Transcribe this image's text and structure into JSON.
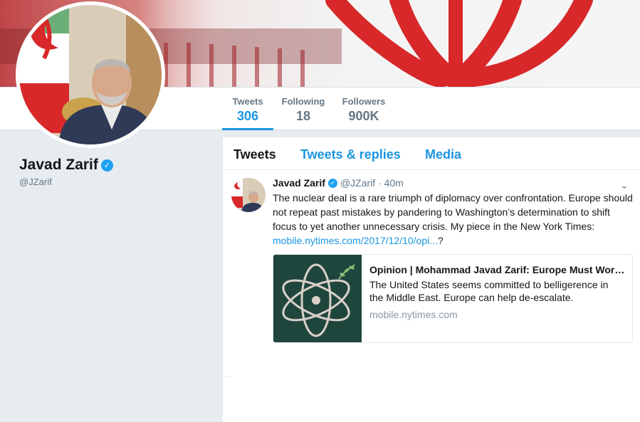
{
  "profile": {
    "name": "Javad Zarif",
    "handle": "@JZarif"
  },
  "stats": [
    {
      "label": "Tweets",
      "value": "306"
    },
    {
      "label": "Following",
      "value": "18"
    },
    {
      "label": "Followers",
      "value": "900K"
    }
  ],
  "timeline_tabs": [
    "Tweets",
    "Tweets & replies",
    "Media"
  ],
  "tweet": {
    "author": "Javad Zarif",
    "meta": "@JZarif · 40m",
    "text": "The nuclear deal is a rare triumph of diplomacy over confrontation. Europe should not repeat past mistakes by pandering to Washington’s determination to shift focus to yet another unnecessary crisis. My piece in the New York Times: ",
    "link": "mobile.nytimes.com/2017/12/10/opi...",
    "suffix": "?",
    "card": {
      "title": "Opinion | Mohammad Javad Zarif: Europe Must Work With Iran",
      "description": "The United States seems committed to belligerence in the Middle East. Europe can help de-escalate.",
      "url": "mobile.nytimes.com"
    }
  },
  "icons": {
    "verified": "verified-badge-icon",
    "caret": "chevron-down-icon"
  },
  "colors": {
    "accent": "#1b95e0",
    "flag_red": "#d8282a",
    "card_image_bg": "#1f463d"
  }
}
